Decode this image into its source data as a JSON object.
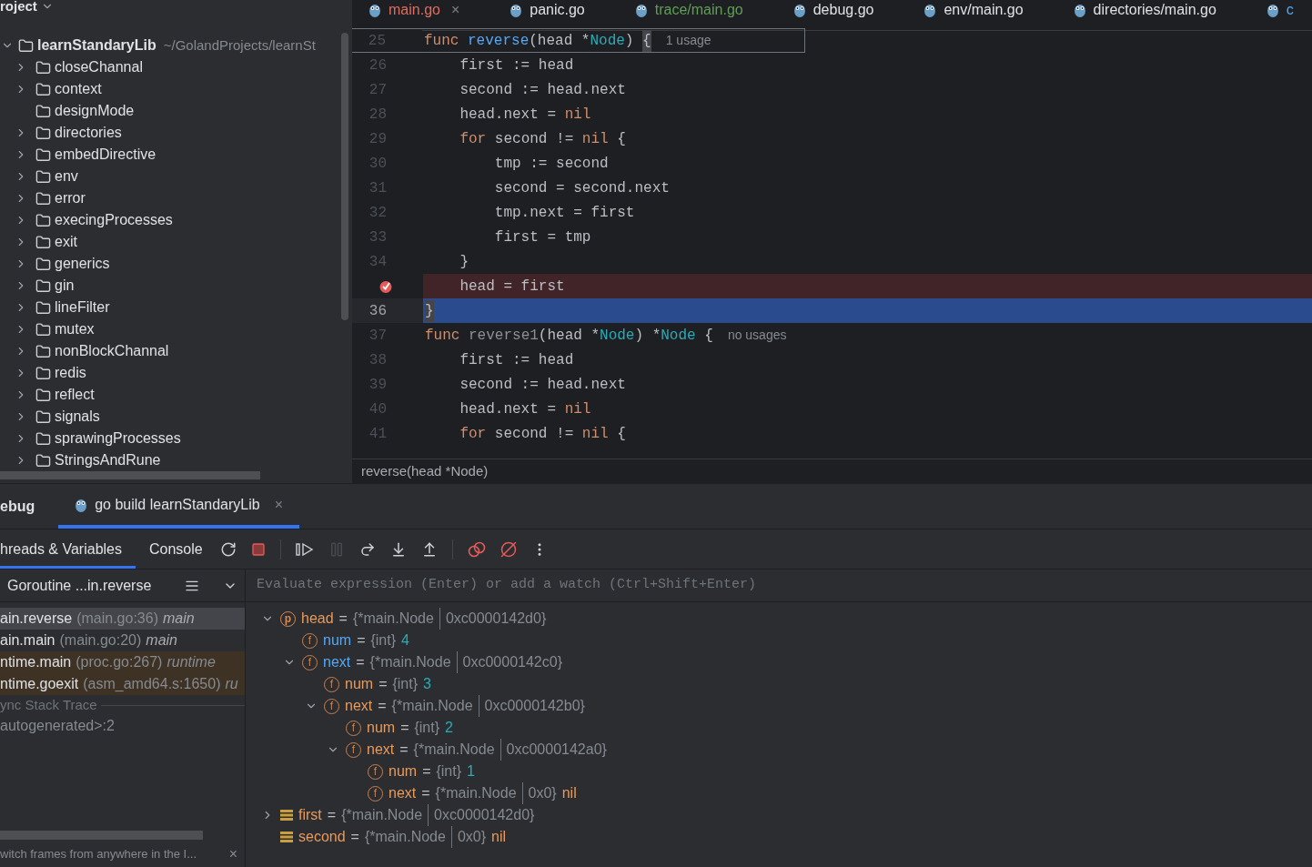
{
  "project": {
    "title": "roject",
    "root": {
      "name": "learnStandaryLib",
      "path": "~/GolandProjects/learnSt",
      "expanded": true,
      "children": [
        {
          "name": "closeChannal",
          "expanded": false
        },
        {
          "name": "context",
          "expanded": false
        },
        {
          "name": "designMode"
        },
        {
          "name": "directories",
          "expanded": false
        },
        {
          "name": "embedDirective",
          "expanded": false
        },
        {
          "name": "env",
          "expanded": false
        },
        {
          "name": "error",
          "expanded": false
        },
        {
          "name": "execingProcesses",
          "expanded": false
        },
        {
          "name": "exit",
          "expanded": false
        },
        {
          "name": "generics",
          "expanded": false
        },
        {
          "name": "gin",
          "expanded": false
        },
        {
          "name": "lineFilter",
          "expanded": false
        },
        {
          "name": "mutex",
          "expanded": false
        },
        {
          "name": "nonBlockChannal",
          "expanded": false
        },
        {
          "name": "redis",
          "expanded": false
        },
        {
          "name": "reflect",
          "expanded": false
        },
        {
          "name": "signals",
          "expanded": false
        },
        {
          "name": "sprawingProcesses",
          "expanded": false
        },
        {
          "name": "StringsAndRune",
          "expanded": false
        }
      ]
    }
  },
  "editor": {
    "tabs": [
      {
        "label": "main.go",
        "selected": true,
        "color": "#e06c5f",
        "close": "×"
      },
      {
        "label": "panic.go",
        "selected": false,
        "color": "#dfe1e5"
      },
      {
        "label": "trace/main.go",
        "selected": false,
        "color": "#5f9e57"
      },
      {
        "label": "debug.go",
        "selected": false,
        "color": "#dfe1e5"
      },
      {
        "label": "env/main.go",
        "selected": false,
        "color": "#dfe1e5"
      },
      {
        "label": "directories/main.go",
        "selected": false,
        "color": "#dfe1e5"
      },
      {
        "label": "c",
        "selected": false,
        "color": "#56a8f5"
      }
    ],
    "lines": [
      {
        "number": "25",
        "kind": "sticky",
        "hint": "1 usage",
        "tokens": [
          {
            "t": "func ",
            "kind": "keyword"
          },
          {
            "t": "reverse",
            "kind": "function"
          },
          {
            "t": "(head *",
            "kind": "plain"
          },
          {
            "t": "Node",
            "kind": "type"
          },
          {
            "t": ") ",
            "kind": "plain"
          },
          {
            "t": "{",
            "kind": "brace"
          }
        ]
      },
      {
        "number": "26",
        "kind": "normal",
        "tokens": [
          {
            "t": "    first := head",
            "kind": "plain"
          }
        ]
      },
      {
        "number": "27",
        "kind": "normal",
        "tokens": [
          {
            "t": "    second := head.next",
            "kind": "plain"
          }
        ]
      },
      {
        "number": "28",
        "kind": "normal",
        "tokens": [
          {
            "t": "    head.next = ",
            "kind": "plain"
          },
          {
            "t": "nil",
            "kind": "keyword"
          }
        ]
      },
      {
        "number": "29",
        "kind": "normal",
        "tokens": [
          {
            "t": "    for",
            "kind": "keyword"
          },
          {
            "t": " second != ",
            "kind": "plain"
          },
          {
            "t": "nil",
            "kind": "keyword"
          },
          {
            "t": " {",
            "kind": "plain"
          }
        ]
      },
      {
        "number": "30",
        "kind": "normal",
        "tokens": [
          {
            "t": "        tmp := second",
            "kind": "plain"
          }
        ]
      },
      {
        "number": "31",
        "kind": "normal",
        "tokens": [
          {
            "t": "        second = second.next",
            "kind": "plain"
          }
        ]
      },
      {
        "number": "32",
        "kind": "normal",
        "tokens": [
          {
            "t": "        tmp.next = first",
            "kind": "plain"
          }
        ]
      },
      {
        "number": "33",
        "kind": "normal",
        "tokens": [
          {
            "t": "        first = tmp",
            "kind": "plain"
          }
        ]
      },
      {
        "number": "34",
        "kind": "normal",
        "tokens": [
          {
            "t": "    }",
            "kind": "plain"
          }
        ]
      },
      {
        "kind": "breakpoint",
        "tokens": [
          {
            "t": "    head = first",
            "kind": "plain"
          }
        ]
      },
      {
        "number": "36",
        "kind": "current",
        "tokens": [
          {
            "t": "}",
            "kind": "brace"
          }
        ]
      },
      {
        "number": "37",
        "kind": "normal",
        "hint": "no usages",
        "tokens": [
          {
            "t": "func ",
            "kind": "keyword"
          },
          {
            "t": "reverse1",
            "kind": "unused"
          },
          {
            "t": "(head *",
            "kind": "plain"
          },
          {
            "t": "Node",
            "kind": "type"
          },
          {
            "t": ") *",
            "kind": "plain"
          },
          {
            "t": "Node",
            "kind": "type"
          },
          {
            "t": " {",
            "kind": "plain"
          }
        ]
      },
      {
        "number": "38",
        "kind": "normal",
        "tokens": [
          {
            "t": "    first := head",
            "kind": "plain"
          }
        ]
      },
      {
        "number": "39",
        "kind": "normal",
        "tokens": [
          {
            "t": "    second := head.next",
            "kind": "plain"
          }
        ]
      },
      {
        "number": "40",
        "kind": "normal",
        "tokens": [
          {
            "t": "    head.next = ",
            "kind": "plain"
          },
          {
            "t": "nil",
            "kind": "keyword"
          }
        ]
      },
      {
        "number": "41",
        "kind": "normal",
        "tokens": [
          {
            "t": "    for",
            "kind": "keyword"
          },
          {
            "t": " second != ",
            "kind": "plain"
          },
          {
            "t": "nil",
            "kind": "keyword"
          },
          {
            "t": " {",
            "kind": "plain"
          }
        ]
      }
    ],
    "breadcrumb": "reverse(head *Node)"
  },
  "debug": {
    "title": "ebug",
    "session": {
      "label": "go build learnStandaryLib",
      "selected": true,
      "close": "×"
    },
    "tabs": [
      {
        "label": "hreads & Variables",
        "selected": true
      },
      {
        "label": "Console",
        "selected": false
      }
    ],
    "toolbar": [
      {
        "kind": "rerun",
        "disabled": false
      },
      {
        "kind": "stop",
        "disabled": false
      },
      {
        "kind": "sep"
      },
      {
        "kind": "resume",
        "disabled": false
      },
      {
        "kind": "pause",
        "disabled": true
      },
      {
        "kind": "step-over",
        "disabled": false
      },
      {
        "kind": "step-into",
        "disabled": false
      },
      {
        "kind": "step-out",
        "disabled": false
      },
      {
        "kind": "sep"
      },
      {
        "kind": "breakpoints",
        "disabled": false
      },
      {
        "kind": "mute",
        "disabled": false
      },
      {
        "kind": "more",
        "disabled": false
      }
    ],
    "goroutine": "Goroutine ...in.reverse",
    "frames": [
      {
        "name": "ain.reverse",
        "location": "(main.go:36)",
        "package": "main",
        "kind": "user",
        "selected": true
      },
      {
        "name": "ain.main",
        "location": "(main.go:20)",
        "package": "main",
        "kind": "user",
        "selected": false
      },
      {
        "name": "ntime.main",
        "location": "(proc.go:267)",
        "package": "runtime",
        "kind": "library",
        "selected": false
      },
      {
        "name": "ntime.goexit",
        "location": "(asm_amd64.s:1650)",
        "package": "ru",
        "kind": "library",
        "selected": false
      }
    ],
    "async_label": "ync Stack Trace",
    "async_frames": [
      "autogenerated>:2"
    ],
    "hint": "witch frames from anywhere in the I...",
    "hint_close": "×",
    "evaluate_placeholder": "Evaluate expression (Enter) or add a watch (Ctrl+Shift+Enter)",
    "variables": [
      {
        "badge": "p",
        "kind": "param",
        "name": "head",
        "eq": "=",
        "type": "{*main.Node",
        "address": "0xc0000142d0}",
        "changed": false,
        "expanded": true,
        "children": [
          {
            "badge": "f",
            "kind": "field",
            "name": "num",
            "eq": "=",
            "type": "{int}",
            "value": "4",
            "changed": true
          },
          {
            "badge": "f",
            "kind": "field",
            "name": "next",
            "eq": "=",
            "type": "{*main.Node",
            "address": "0xc0000142c0}",
            "changed": true,
            "expanded": true,
            "children": [
              {
                "badge": "f",
                "kind": "field",
                "name": "num",
                "eq": "=",
                "type": "{int}",
                "value": "3",
                "changed": false
              },
              {
                "badge": "f",
                "kind": "field",
                "name": "next",
                "eq": "=",
                "type": "{*main.Node",
                "address": "0xc0000142b0}",
                "changed": false,
                "expanded": true,
                "children": [
                  {
                    "badge": "f",
                    "kind": "field",
                    "name": "num",
                    "eq": "=",
                    "type": "{int}",
                    "value": "2",
                    "changed": false
                  },
                  {
                    "badge": "f",
                    "kind": "field",
                    "name": "next",
                    "eq": "=",
                    "type": "{*main.Node",
                    "address": "0xc0000142a0}",
                    "changed": false,
                    "expanded": true,
                    "children": [
                      {
                        "badge": "f",
                        "kind": "field",
                        "name": "num",
                        "eq": "=",
                        "type": "{int}",
                        "value": "1",
                        "changed": false
                      },
                      {
                        "badge": "f",
                        "kind": "field",
                        "name": "next",
                        "eq": "=",
                        "type": "{*main.Node",
                        "address": "0x0}",
                        "value": "nil",
                        "changed": false
                      }
                    ]
                  }
                ]
              }
            ]
          }
        ]
      },
      {
        "kind": "local",
        "name": "first",
        "eq": "=",
        "type": "{*main.Node",
        "address": "0xc0000142d0}",
        "changed": false,
        "expanded": false
      },
      {
        "kind": "local",
        "name": "second",
        "eq": "=",
        "type": "{*main.Node",
        "address": "0x0}",
        "value": "nil",
        "changed": false
      }
    ]
  }
}
